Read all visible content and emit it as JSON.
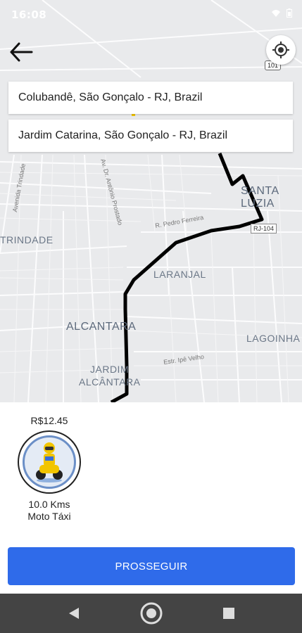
{
  "status_bar": {
    "time": "16:08"
  },
  "map": {
    "route_badge": "RJ-104",
    "highway_badge": "101",
    "labels": {
      "santa_luzia": "SANTA LUZIA",
      "trindade": "TRINDADE",
      "laranjal": "LARANJAL",
      "alcantara": "ALCANTARA",
      "lagoinha": "LAGOINHA",
      "jardim_alcantara_1": "JARDIM",
      "jardim_alcantara_2": "ALCÂNTARA",
      "r_pedro_ferreira": "R. Pedro Ferreira",
      "av_antonio": "Av. Dr. Antônio Prostado",
      "avenida": "Avenida Trindade",
      "estr_velho": "Estr. Ipê Velho"
    }
  },
  "addresses": {
    "origin": "Colubandê, São Gonçalo - RJ, Brazil",
    "destination": "Jardim Catarina, São Gonçalo - RJ, Brazil"
  },
  "service": {
    "price": "R$12.45",
    "distance": "10.0 Kms",
    "name": "Moto Táxi",
    "icon": "moto-taxi-icon"
  },
  "cta": {
    "label": "PROSSEGUIR"
  },
  "colors": {
    "primary": "#2f6bea",
    "route": "#000000",
    "navbar": "#444444"
  },
  "icons": {
    "back": "arrow-left-icon",
    "locate": "gps-locate-icon",
    "nav_back": "triangle-back-icon",
    "nav_home": "circle-home-icon",
    "nav_recent": "square-recent-icon"
  }
}
